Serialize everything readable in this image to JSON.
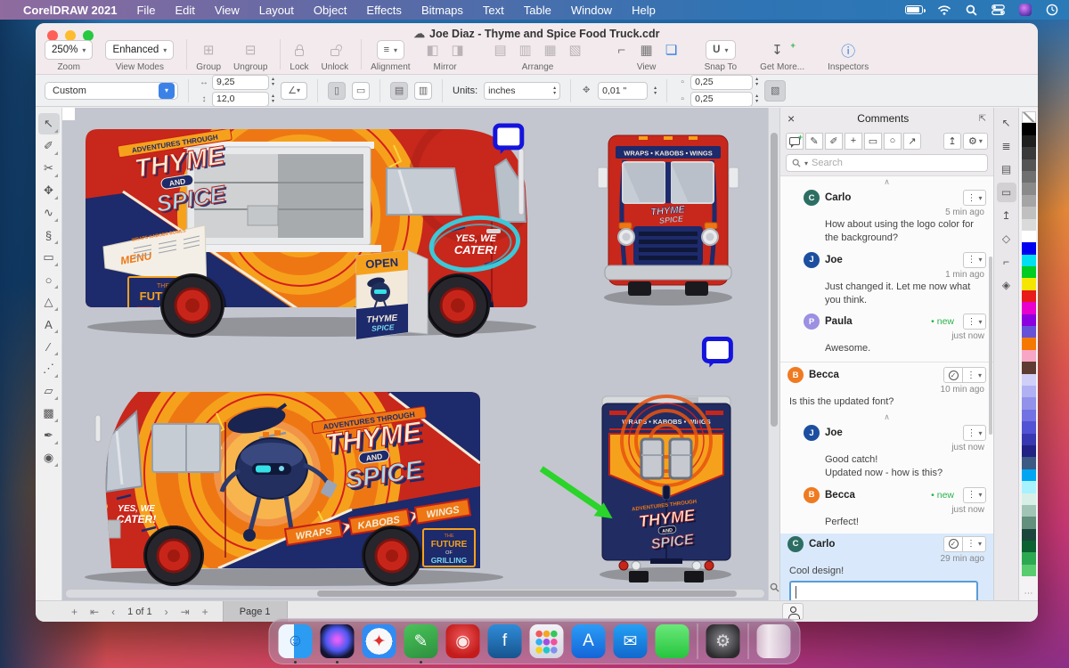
{
  "icons": {
    "chevron_down": "▾",
    "caret_up": "∧",
    "menu_dots": "⋮",
    "check": "✓",
    "close": "×",
    "ellipsis": "⋯",
    "cloud": "☁",
    "gear": "⚙",
    "info": "ⓘ",
    "plus": "+",
    "apple": "",
    "prev": "‹",
    "next": "›",
    "first": "⇤",
    "last": "⇥",
    "arrow_share": "↥",
    "down_get": "↧"
  },
  "menubar": {
    "app_name": "CorelDRAW 2021",
    "items": [
      "File",
      "Edit",
      "View",
      "Layout",
      "Object",
      "Effects",
      "Bitmaps",
      "Text",
      "Table",
      "Window",
      "Help"
    ]
  },
  "window": {
    "title": "Joe Diaz - Thyme and Spice Food Truck.cdr"
  },
  "toolbar": {
    "zoom_value": "250%",
    "zoom_label": "Zoom",
    "viewmodes_value": "Enhanced",
    "viewmodes_label": "View Modes",
    "group_label": "Group",
    "ungroup_label": "Ungroup",
    "lock_label": "Lock",
    "unlock_label": "Unlock",
    "alignment_label": "Alignment",
    "mirror_label": "Mirror",
    "arrange_label": "Arrange",
    "view_label": "View",
    "snapto_label": "Snap To",
    "snapto_glyph": "U",
    "getmore_label": "Get More...",
    "inspectors_label": "Inspectors"
  },
  "propertybar": {
    "preset": "Custom",
    "width": "9,25",
    "height": "12,0",
    "units_label": "Units:",
    "units_value": "inches",
    "nudge": "0,01 \"",
    "dup_x": "0,25",
    "dup_y": "0,25"
  },
  "toolbox": {
    "tools": [
      {
        "name": "tool-pick",
        "glyph": "↖",
        "cls": "selected"
      },
      {
        "name": "tool-shape",
        "glyph": "✐",
        "cls": ""
      },
      {
        "name": "tool-crop",
        "glyph": "✂",
        "cls": ""
      },
      {
        "name": "tool-pan",
        "glyph": "✥",
        "cls": ""
      },
      {
        "name": "tool-dimension",
        "glyph": "∿",
        "cls": ""
      },
      {
        "name": "tool-curve",
        "glyph": "§",
        "cls": ""
      },
      {
        "name": "tool-rectangle",
        "glyph": "▭",
        "cls": ""
      },
      {
        "name": "tool-ellipse",
        "glyph": "○",
        "cls": ""
      },
      {
        "name": "tool-polygon",
        "glyph": "△",
        "cls": ""
      },
      {
        "name": "tool-text",
        "glyph": "A",
        "cls": ""
      },
      {
        "name": "tool-line",
        "glyph": "∕",
        "cls": ""
      },
      {
        "name": "tool-connector",
        "glyph": "⋰",
        "cls": ""
      },
      {
        "name": "tool-transparency",
        "glyph": "▱",
        "cls": ""
      },
      {
        "name": "tool-pattern",
        "glyph": "▩",
        "cls": ""
      },
      {
        "name": "tool-eyedropper",
        "glyph": "✒",
        "cls": ""
      },
      {
        "name": "tool-interactive-fill",
        "glyph": "◉",
        "cls": ""
      }
    ]
  },
  "artwork": {
    "logo": {
      "adventures": "ADVENTURES THROUGH",
      "thyme": "THYME",
      "and": "AND",
      "spice": "SPICE"
    },
    "banner": {
      "wraps": "WRAPS",
      "kabobs": "KABOBS",
      "wings": "WINGS",
      "joined": "WRAPS • KABOBS • WINGS"
    },
    "cater1": "YES, WE",
    "cater2": "CATER!",
    "menu": "MENU",
    "menu_cols": "WRAPS  KABOBS  BOWLS",
    "open": "OPEN",
    "future": {
      "the": "THE",
      "future": "FUTURE",
      "of": "OF",
      "grilling": "GRILLING"
    }
  },
  "comments_panel": {
    "title": "Comments",
    "search_placeholder": "Search",
    "items": [
      {
        "initial": "C",
        "author": "Carlo",
        "color": "#2d6e63",
        "time": "5 min ago",
        "text": "How about using the logo color for the background?"
      },
      {
        "initial": "J",
        "author": "Joe",
        "color": "#1d4fa0",
        "time": "1 min ago",
        "text": "Just changed it. Let me now what you think."
      },
      {
        "initial": "P",
        "author": "Paula",
        "color": "#9b90e2",
        "time": "just now",
        "badge": "new",
        "text": "Awesome."
      },
      {
        "initial": "B",
        "author": "Becca",
        "color": "#f07a20",
        "time": "10 min ago",
        "text": "Is this the updated font?"
      },
      {
        "initial": "J",
        "author": "Joe",
        "color": "#1d4fa0",
        "time": "just now",
        "text": "Good catch!\nUpdated now - how is this?"
      },
      {
        "initial": "B",
        "author": "Becca",
        "color": "#f07a20",
        "time": "just now",
        "badge": "new",
        "text": "Perfect!"
      },
      {
        "initial": "C",
        "author": "Carlo",
        "color": "#2d6e63",
        "time": "29 min ago",
        "text": "Cool design!"
      }
    ]
  },
  "inspector_tabs": [
    {
      "name": "hints-icon",
      "glyph": "↖",
      "cls": ""
    },
    {
      "name": "text-properties-icon",
      "glyph": "≣",
      "cls": ""
    },
    {
      "name": "pages-icon",
      "glyph": "▤",
      "cls": ""
    },
    {
      "name": "comments-icon",
      "glyph": "▭",
      "cls": "active"
    },
    {
      "name": "export-icon",
      "glyph": "↥",
      "cls": ""
    },
    {
      "name": "color-styles-icon",
      "glyph": "◇",
      "cls": ""
    },
    {
      "name": "guidelines-icon",
      "glyph": "⌐",
      "cls": ""
    },
    {
      "name": "objects-icon",
      "glyph": "◈",
      "cls": ""
    }
  ],
  "palette": {
    "colors": [
      "#000000",
      "#1f1f1f",
      "#3a3a3a",
      "#555555",
      "#707070",
      "#8a8a8a",
      "#a5a5a5",
      "#c0c0c0",
      "#dadada",
      "#ffffff",
      "#0000f0",
      "#00dff0",
      "#00cc22",
      "#f5e600",
      "#e81a1a",
      "#e800cc",
      "#8c00e0",
      "#6652d8",
      "#f57900",
      "#f8a6c6",
      "#5e3c34",
      "#cfcff8",
      "#b0b0f2",
      "#9292ea",
      "#7272e2",
      "#5252d4",
      "#3838b0",
      "#222284",
      "#3c5a84",
      "#00a6f2",
      "#a8f2ff",
      "#d8efe8",
      "#a0c4b6",
      "#628f7e",
      "#1a453c",
      "#0c6130",
      "#2ca851",
      "#58cc6e"
    ]
  },
  "statusbar": {
    "page_indicator": "1 of 1",
    "page_tab": "Page 1"
  },
  "dock": {
    "apps": [
      {
        "name": "dock-finder-icon",
        "bg": "linear-gradient(90deg,#eef6ff 0 46%,#2b9cf2 46%)",
        "glyph": "☺",
        "gc": "#1b6bbf",
        "cls": "running"
      },
      {
        "name": "dock-siri-icon",
        "bg": "radial-gradient(circle at 50% 45%, #e060f8 8%, #4a58f0 45%, #141430 72%)",
        "glyph": "",
        "gc": "",
        "cls": "running"
      },
      {
        "name": "dock-safari-icon",
        "bg": "radial-gradient(circle,#f8f8f8 0 55%,#2f8cf4 55%)",
        "glyph": "✦",
        "gc": "#e03030",
        "cls": ""
      },
      {
        "name": "dock-coreldraw-icon",
        "bg": "linear-gradient(160deg,#49c45a,#2d8f3e)",
        "glyph": "✎",
        "gc": "#ffffff",
        "cls": "running"
      },
      {
        "name": "dock-photo-paint-icon",
        "bg": "radial-gradient(circle at 50% 40%,#e85050 10%,#c41c1c 70%)",
        "glyph": "◉",
        "gc": "#f8e8e8",
        "cls": ""
      },
      {
        "name": "dock-font-manager-icon",
        "bg": "linear-gradient(180deg,#2f8cd8,#16548e)",
        "glyph": "f",
        "gc": "#ffffff",
        "cls": ""
      },
      {
        "name": "dock-launchpad-icon",
        "bg": "radial-gradient(circle at 28% 28%,#f05a5a 3.5px,transparent 4px),radial-gradient(circle at 50% 28%,#f5a623 3.5px,transparent 4px),radial-gradient(circle at 72% 28%,#34c759 3.5px,transparent 4px),radial-gradient(circle at 28% 52%,#30b0f0 3.5px,transparent 4px),radial-gradient(circle at 50% 52%,#a050e0 3.5px,transparent 4px),radial-gradient(circle at 72% 52%,#f050a0 3.5px,transparent 4px),radial-gradient(circle at 28% 76%,#f5d020 3.5px,transparent 4px),radial-gradient(circle at 50% 76%,#20c8c8 3.5px,transparent 4px),radial-gradient(circle at 72% 76%,#8090f0 3.5px,transparent 4px),linear-gradient(180deg,#f2f2f7,#d5d5e0)",
        "glyph": "",
        "gc": "",
        "cls": ""
      },
      {
        "name": "dock-appstore-icon",
        "bg": "linear-gradient(180deg,#2b9cf6,#1465d8)",
        "glyph": "A",
        "gc": "#ffffff",
        "cls": ""
      },
      {
        "name": "dock-mail-icon",
        "bg": "linear-gradient(180deg,#24a0f4,#1268cc)",
        "glyph": "✉",
        "gc": "#ffffff",
        "cls": ""
      },
      {
        "name": "dock-messages-icon",
        "bg": "linear-gradient(180deg,#6ae87a,#26c53e)",
        "glyph": "",
        "gc": "",
        "cls": "bub"
      },
      {
        "name": "dock-divider",
        "bg": "",
        "glyph": "",
        "gc": "",
        "cls": "divider"
      },
      {
        "name": "dock-system-preferences-icon",
        "bg": "radial-gradient(circle at 50% 45%,#7a7a80 15%,#2c2c2e 75%)",
        "glyph": "⚙",
        "gc": "#d8d8dc",
        "cls": ""
      },
      {
        "name": "dock-divider",
        "bg": "",
        "glyph": "",
        "gc": "",
        "cls": "divider"
      },
      {
        "name": "dock-trash-icon",
        "bg": "linear-gradient(90deg,rgba(255,255,255,.55),rgba(255,255,255,.85) 35%,rgba(230,230,240,.6))",
        "glyph": "",
        "gc": "",
        "cls": ""
      }
    ]
  }
}
